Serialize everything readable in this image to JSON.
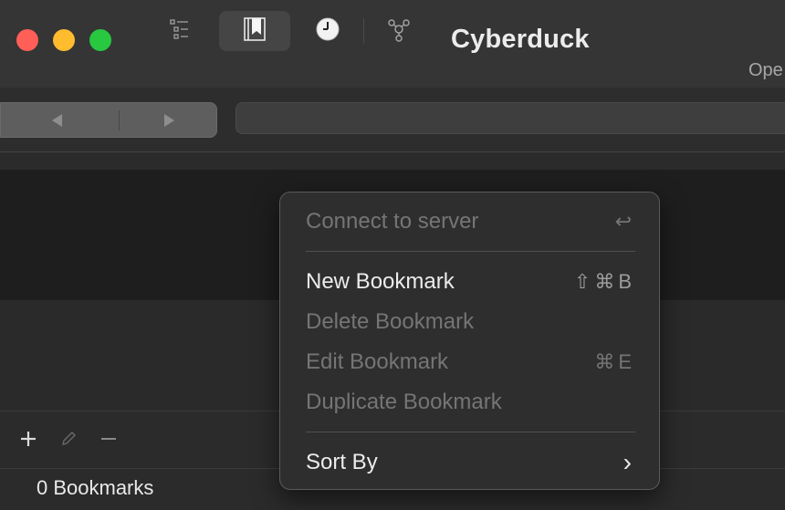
{
  "window": {
    "title": "Cyberduck",
    "open_label": "Ope"
  },
  "toolbar": {
    "items": [
      {
        "icon": "outline-view-icon"
      },
      {
        "icon": "bookmarks-icon",
        "selected": true
      },
      {
        "icon": "history-icon"
      },
      {
        "icon": "bonjour-icon"
      }
    ]
  },
  "navigation": {
    "back_icon": "back-arrow-icon",
    "forward_icon": "forward-arrow-icon"
  },
  "context_menu": {
    "items": [
      {
        "label": "Connect to server",
        "shortcut": "↩",
        "enabled": false
      },
      {
        "label": "New Bookmark",
        "shortcut": "⇧⌘B",
        "enabled": true
      },
      {
        "label": "Delete Bookmark",
        "shortcut": "",
        "enabled": false
      },
      {
        "label": "Edit Bookmark",
        "shortcut": "⌘E",
        "enabled": false
      },
      {
        "label": "Duplicate Bookmark",
        "shortcut": "",
        "enabled": false
      },
      {
        "label": "Sort By",
        "shortcut": "›",
        "enabled": true,
        "submenu": true
      }
    ]
  },
  "bottom_bar": {
    "add_icon": "plus-icon",
    "edit_icon": "pencil-icon",
    "remove_icon": "minus-icon",
    "status": "0 Bookmarks"
  },
  "colors": {
    "close": "#ff5f57",
    "minimize": "#febc2e",
    "zoom": "#28c840"
  }
}
